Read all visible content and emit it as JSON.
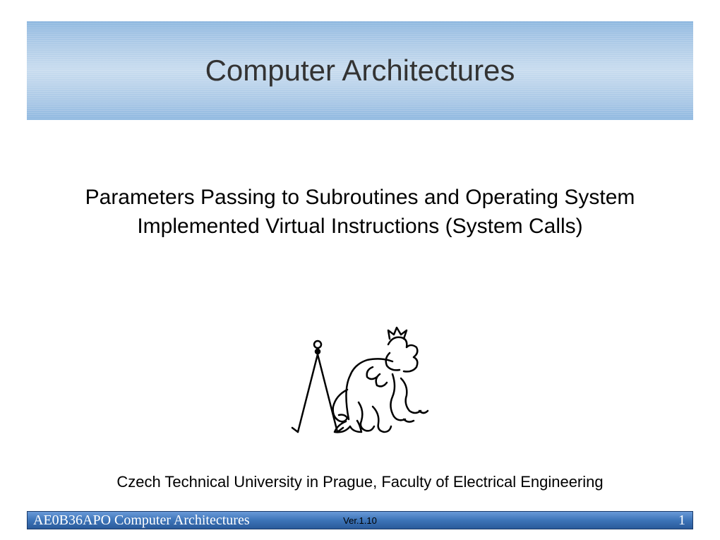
{
  "header": {
    "title": "Computer Architectures"
  },
  "main": {
    "subtitle": "Parameters Passing to Subroutines and Operating System Implemented Virtual Instructions (System Calls)",
    "institution": "Czech Technical University in Prague, Faculty of Electrical Engineering"
  },
  "footer": {
    "course": "AE0B36APO   Computer Architectures",
    "version": "Ver.1.10",
    "page": "1"
  },
  "logo": {
    "name": "ctu-lion-logo"
  }
}
